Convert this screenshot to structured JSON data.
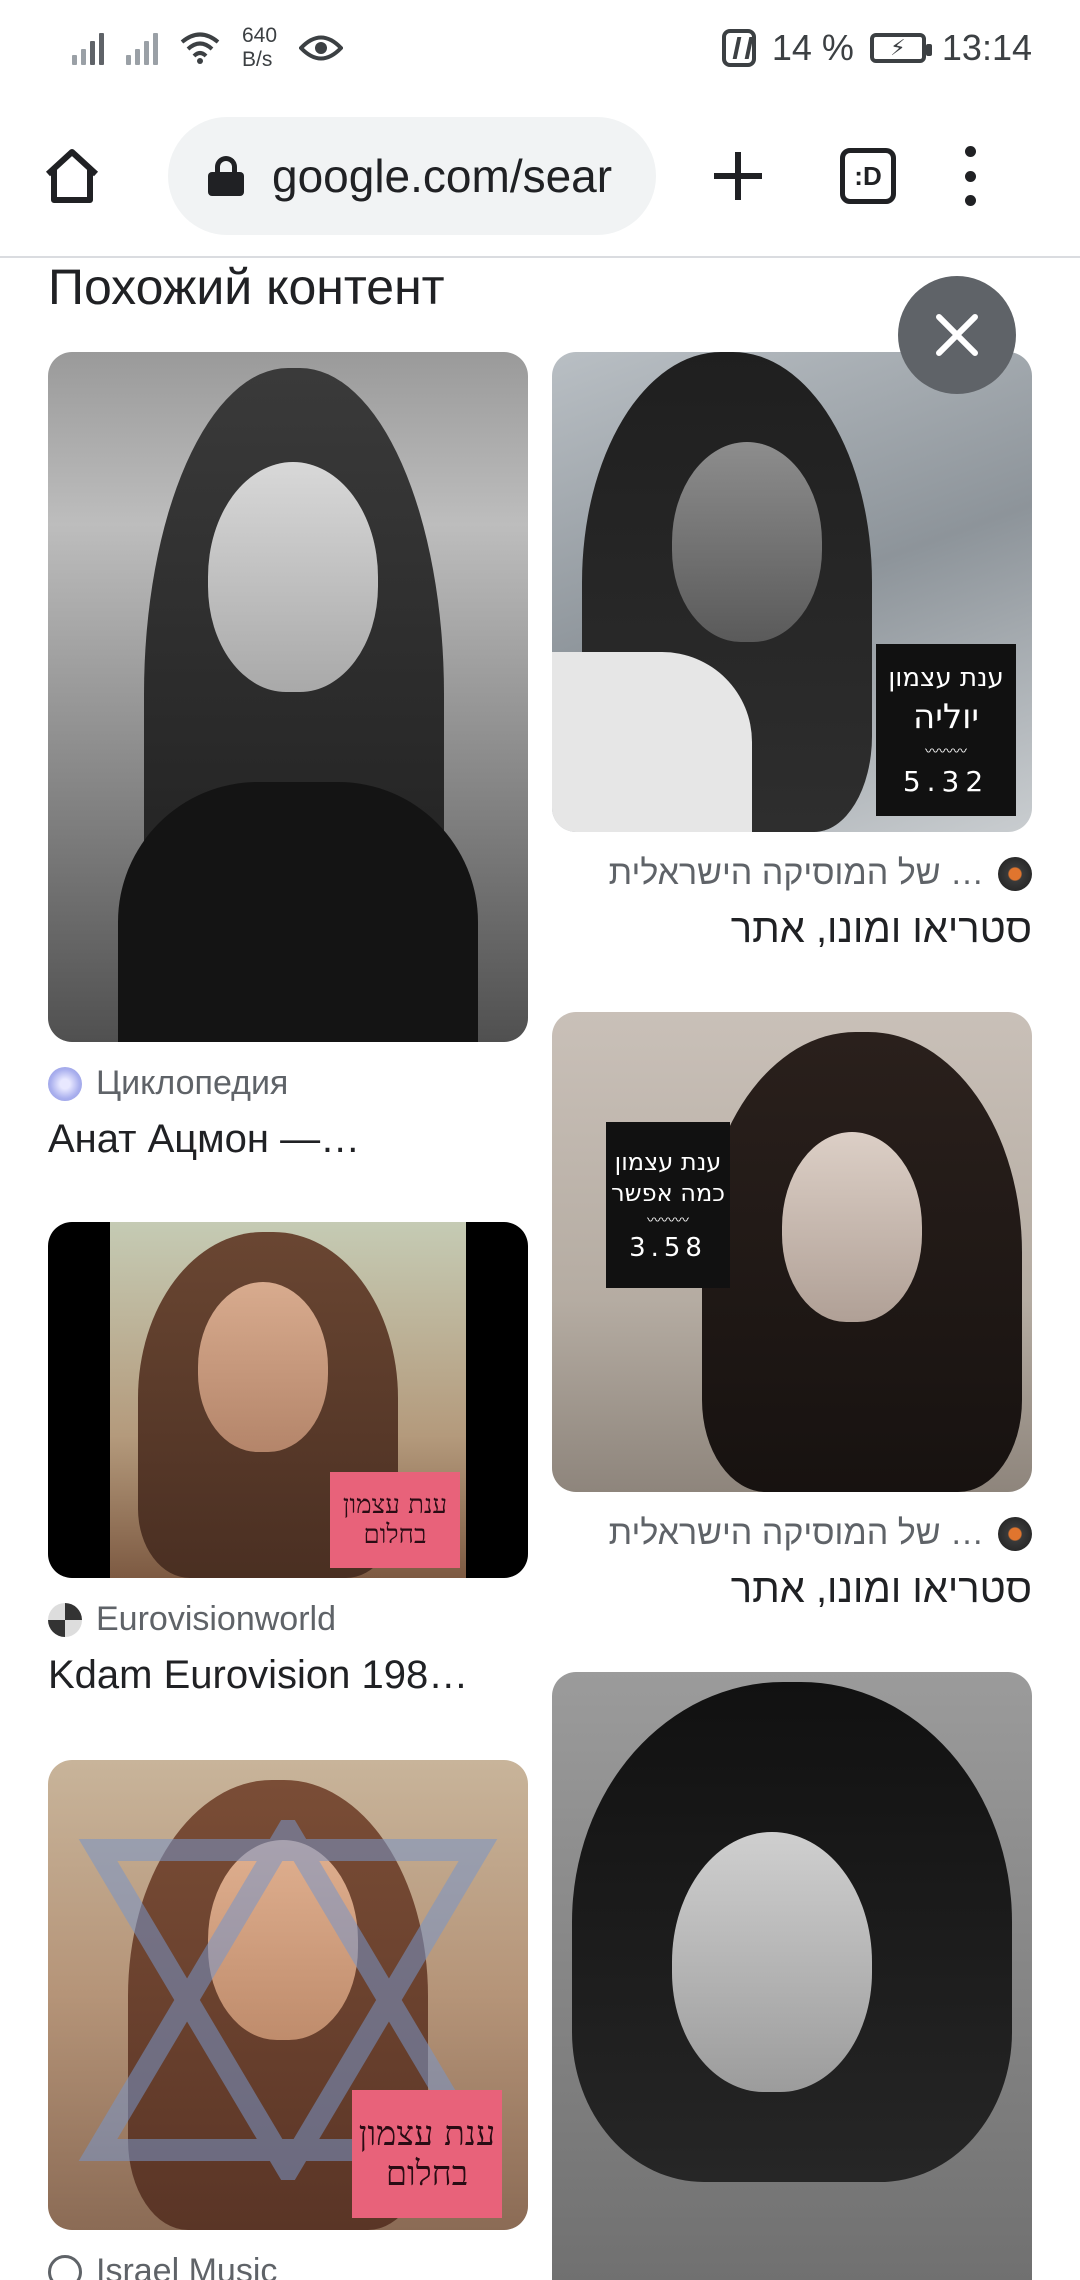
{
  "status_bar": {
    "net_speed_value": "640",
    "net_speed_unit": "B/s",
    "battery_percent": "14 %",
    "time": "13:14",
    "icons": [
      "signal-icon",
      "signal-icon",
      "wifi-icon",
      "eye-icon",
      "nfc-icon",
      "battery-charging-icon"
    ]
  },
  "toolbar": {
    "url": "google.com/sear",
    "tabs_label": ":D",
    "icons": [
      "home-icon",
      "lock-icon",
      "plus-icon",
      "tabs-icon",
      "more-vert-icon"
    ]
  },
  "section": {
    "title": "Похожий контент",
    "close_icon": "close-icon"
  },
  "cards": [
    {
      "source": "Циклопедия",
      "title": "Анат Ацмон —…"
    },
    {
      "source": "… של המוסיקה הישראלית",
      "title": "סטריאו ומונו, אתר",
      "cover_title": "יוליה",
      "cover_artist": "ענת עצמון",
      "cover_time": "5.32"
    },
    {
      "source": "Eurovisionworld",
      "title": "Kdam Eurovision 198…",
      "cover_artist": "ענת עצמון",
      "cover_title": "בחלום"
    },
    {
      "source": "… של המוסיקה הישראלית",
      "title": "סטריאו ומונו, אתר",
      "cover_artist": "ענת עצמון",
      "cover_title": "כמה אפשר",
      "cover_time": "3.58"
    },
    {
      "source": "Israel Music",
      "cover_artist": "ענת עצמון",
      "cover_title": "בחלום"
    },
    {}
  ]
}
